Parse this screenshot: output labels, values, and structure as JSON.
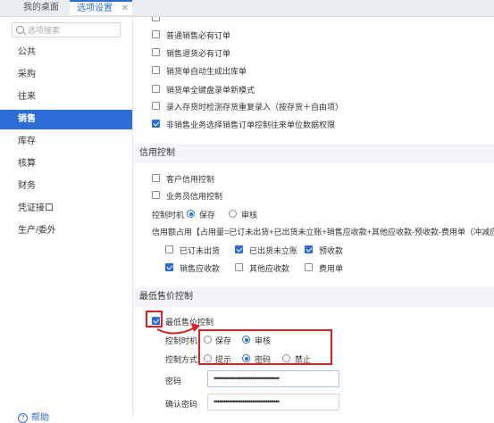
{
  "tabs": [
    {
      "label": "我的桌面"
    },
    {
      "label": "选项设置",
      "close": "✕"
    }
  ],
  "search": {
    "placeholder": "选项搜索"
  },
  "nav": [
    {
      "label": "公共"
    },
    {
      "label": "采购"
    },
    {
      "label": "往来"
    },
    {
      "label": "销售"
    },
    {
      "label": "库存"
    },
    {
      "label": "核算"
    },
    {
      "label": "财务"
    },
    {
      "label": "凭证接口"
    },
    {
      "label": "生产/委外"
    }
  ],
  "help": {
    "label": "帮助"
  },
  "sales_options": [
    {
      "label": "普通销售必有订单",
      "checked": false
    },
    {
      "label": "销售退货必有订单",
      "checked": false
    },
    {
      "label": "销货单自动生成出库单",
      "checked": false
    },
    {
      "label": "销货单全键盘录单新模式",
      "checked": false
    },
    {
      "label": "录入存货时检测存货重复录入（按存货＋自由项）",
      "checked": false
    },
    {
      "label": "非销售业务选择销售订单控制往来单位数据权限",
      "checked": true
    }
  ],
  "credit": {
    "title": "信用控制",
    "customer_credit": "客户信用控制",
    "salesman_credit": "业务员信用控制",
    "timing_label": "控制时机",
    "timing_options": [
      {
        "label": "保存",
        "selected": true
      },
      {
        "label": "审核",
        "selected": false
      }
    ],
    "formula": "信用额占用【占用量=已订未出货+已出货未立账+销售应收款+其他应收款-预收款-费用单（冲减应收）】",
    "items": [
      {
        "label": "已订未出货",
        "checked": false
      },
      {
        "label": "已出货未立账",
        "checked": true
      },
      {
        "label": "预收款",
        "checked": true
      },
      {
        "label": "销售应收款",
        "checked": true
      },
      {
        "label": "其他应收款",
        "checked": false
      },
      {
        "label": "费用单",
        "checked": false
      }
    ]
  },
  "min_price": {
    "title": "最低售价控制",
    "enable_label": "最低售价控制",
    "enabled": true,
    "timing_label": "控制时机",
    "timing_options": [
      {
        "label": "保存",
        "selected": false
      },
      {
        "label": "审核",
        "selected": true
      }
    ],
    "mode_label": "控制方式",
    "mode_options": [
      {
        "label": "提示",
        "selected": false
      },
      {
        "label": "密码",
        "selected": true
      },
      {
        "label": "禁止",
        "selected": false
      }
    ],
    "password_label": "密码",
    "password_value": "••••••••••••••••••••••••••••••••••",
    "confirm_label": "确认密码",
    "confirm_value": "••••••••••••••••••••••••••••••••••"
  },
  "colors": {
    "accent": "#2c6cd6",
    "annotation": "#e02020"
  }
}
